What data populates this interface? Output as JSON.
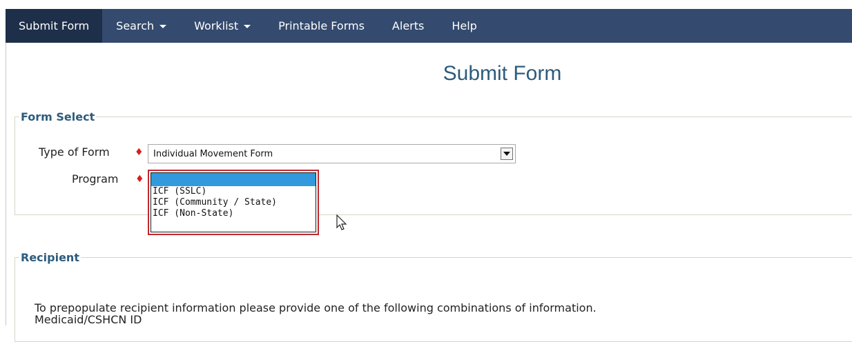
{
  "nav": {
    "items": [
      {
        "label": "Submit Form",
        "dropdown": false,
        "active": true
      },
      {
        "label": "Search",
        "dropdown": true,
        "active": false
      },
      {
        "label": "Worklist",
        "dropdown": true,
        "active": false
      },
      {
        "label": "Printable Forms",
        "dropdown": false,
        "active": false
      },
      {
        "label": "Alerts",
        "dropdown": false,
        "active": false
      },
      {
        "label": "Help",
        "dropdown": false,
        "active": false
      }
    ]
  },
  "page": {
    "title": "Submit Form"
  },
  "form_select": {
    "legend": "Form Select",
    "type_of_form": {
      "label": "Type of Form",
      "value": "Individual Movement Form"
    },
    "program": {
      "label": "Program",
      "options": [
        "",
        "ICF (SSLC)",
        "ICF (Community / State)",
        "ICF (Non-State)"
      ],
      "selected_index": 0
    }
  },
  "recipient": {
    "legend": "Recipient",
    "instructions": "To prepopulate recipient information please provide one of the following combinations of information.",
    "combo_1": "Medicaid/CSHCN ID"
  },
  "colors": {
    "nav_bg": "#344a6e",
    "nav_active_bg": "#1e2f4a",
    "title_color": "#2d5b7c",
    "required_marker": "#d62020",
    "listbox_highlight": "#3399dd",
    "focus_border": "#c0272d"
  }
}
